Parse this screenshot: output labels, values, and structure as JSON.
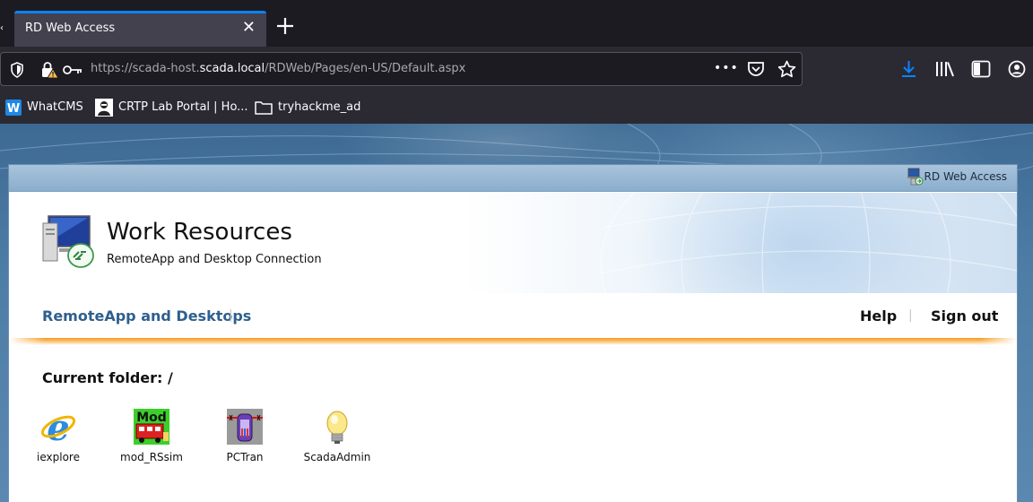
{
  "browser": {
    "tab_title": "RD Web Access",
    "tab_close": "✕",
    "new_tab": "+",
    "url_prefix": "https://scada-host.",
    "url_host": "scada.local",
    "url_path": "/RDWeb/Pages/en-US/Default.aspx",
    "url_more": "•••",
    "accent_color": "#0a84ff"
  },
  "bookmarks": [
    {
      "label": "WhatCMS",
      "icon": "whatcms-icon"
    },
    {
      "label": "CRTP Lab Portal | Ho...",
      "icon": "crtp-icon"
    },
    {
      "label": "tryhackme_ad",
      "icon": "folder-icon"
    }
  ],
  "page": {
    "topbar_label": "RD Web Access",
    "title": "Work Resources",
    "subtitle": "RemoteApp and Desktop Connection",
    "nav_remoteapp": "RemoteApp and Desktops",
    "nav_help": "Help",
    "nav_signout": "Sign out",
    "folder_label": "Current folder: /",
    "link_color": "#2e5f8e",
    "accent_orange": "#f59a1b"
  },
  "apps": [
    {
      "label": "iexplore",
      "icon": "internet-explorer-icon"
    },
    {
      "label": "mod_RSsim",
      "icon": "mod-rssim-icon"
    },
    {
      "label": "PCTran",
      "icon": "pctran-icon"
    },
    {
      "label": "ScadaAdmin",
      "icon": "lightbulb-icon"
    }
  ]
}
